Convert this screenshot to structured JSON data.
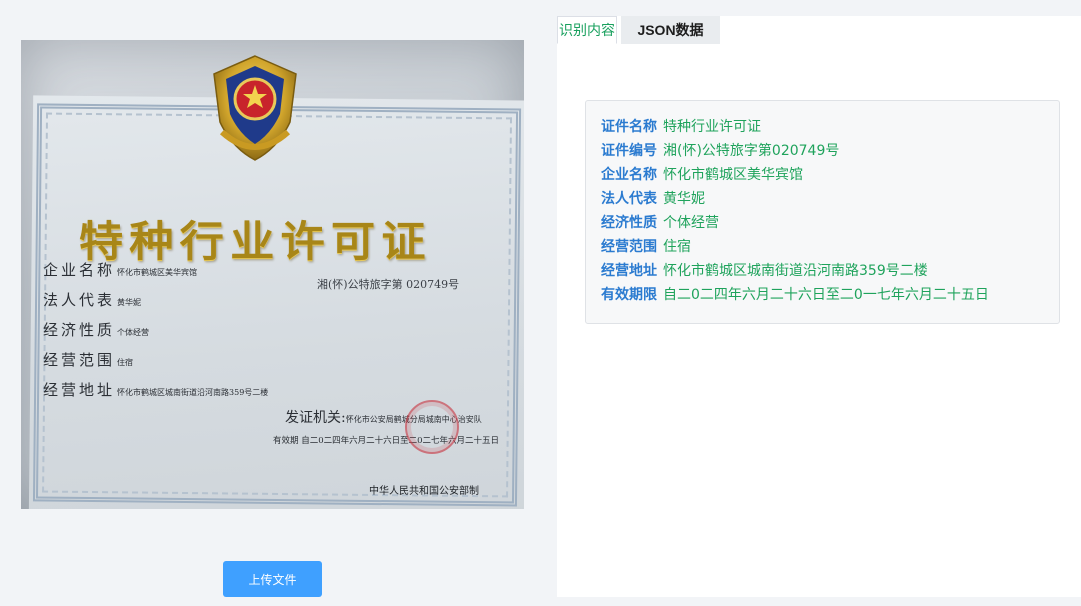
{
  "tabs": [
    {
      "label": "识别内容",
      "active": true
    },
    {
      "label": "JSON数据",
      "active": false
    }
  ],
  "upload_button": "上传文件",
  "result": [
    {
      "key": "证件名称",
      "value": "特种行业许可证"
    },
    {
      "key": "证件编号",
      "value": "湘(怀)公特旅字第020749号"
    },
    {
      "key": "企业名称",
      "value": "怀化市鹤城区美华宾馆"
    },
    {
      "key": "法人代表",
      "value": "黄华妮"
    },
    {
      "key": "经济性质",
      "value": "个体经营"
    },
    {
      "key": "经营范围",
      "value": "住宿"
    },
    {
      "key": "经营地址",
      "value": "怀化市鹤城区城南街道沿河南路359号二楼"
    },
    {
      "key": "有效期限",
      "value": "自二0二四年六月二十六日至二0一七年六月二十五日"
    }
  ],
  "certificate": {
    "title": "特种行业许可证",
    "number": "湘(怀)公特旅字第 020749号",
    "rows": [
      {
        "key": "企业名称",
        "value": "怀化市鹤城区美华宾馆"
      },
      {
        "key": "法人代表",
        "value": "黄华妮"
      },
      {
        "key": "经济性质",
        "value": "个体经营"
      },
      {
        "key": "经营范围",
        "value": "住宿"
      },
      {
        "key": "经营地址",
        "value": "怀化市鹤城区城南街道沿河南路359号二楼"
      }
    ],
    "issuer_key": "发证机关:",
    "issuer_value": "怀化市公安局鹤城分局城南中心治安队",
    "valid": "有效期 自二0二四年六月二十六日至二0二七年六月二十五日",
    "footer": "中华人民共和国公安部制"
  },
  "colors": {
    "upload_button": "#3fa0ff",
    "result_key": "#2b7bd0",
    "result_value": "#1fa35c",
    "active_tab": "#19a05e"
  }
}
